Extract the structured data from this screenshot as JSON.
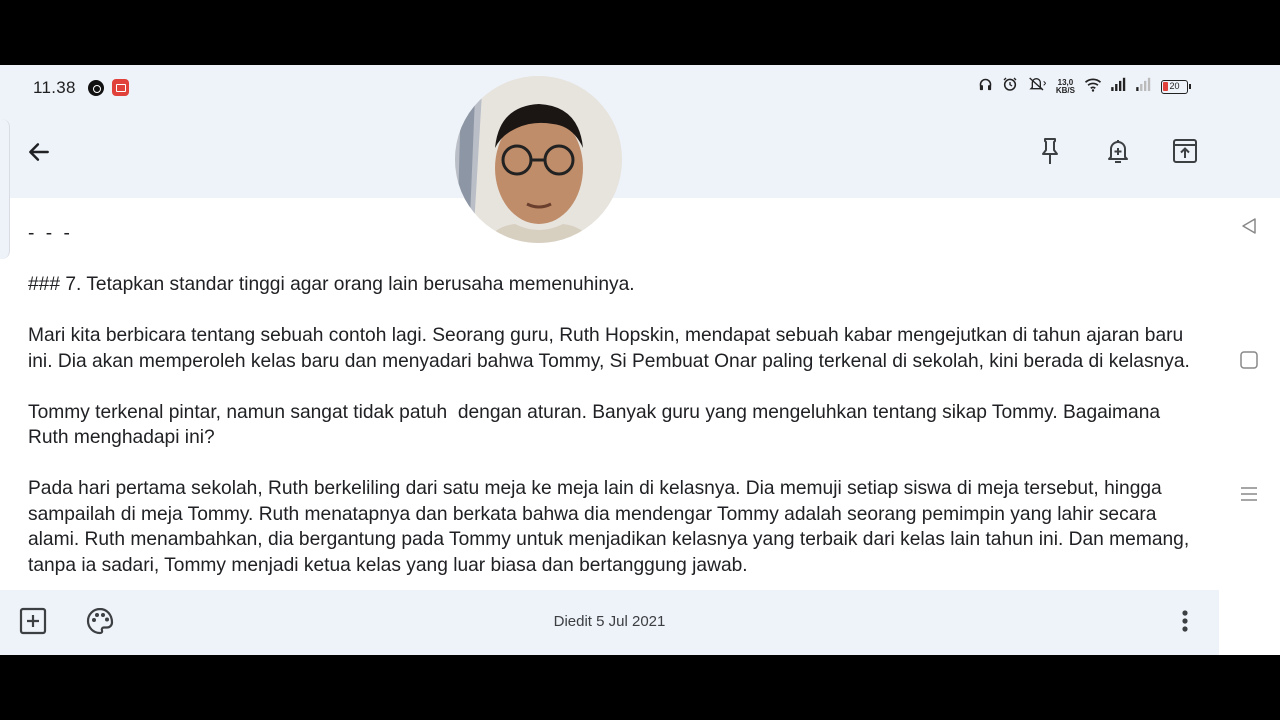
{
  "status_bar": {
    "time": "11.38",
    "network_speed": "13,0",
    "network_speed_unit": "KB/S",
    "battery_level": "20"
  },
  "toolbar": {
    "back_icon": "arrow-left-icon",
    "pin_icon": "pin-icon",
    "reminder_icon": "bell-plus-icon",
    "archive_icon": "archive-icon"
  },
  "note": {
    "separator": "- - -",
    "heading": "### 7. Tetapkan standar tinggi agar orang lain berusaha memenuhinya.",
    "paragraphs": [
      "Mari kita berbicara tentang sebuah contoh lagi. Seorang guru, Ruth Hopskin, mendapat sebuah kabar mengejutkan di tahun ajaran baru ini. Dia akan memperoleh kelas baru dan menyadari bahwa Tommy, Si Pembuat Onar paling terkenal di sekolah, kini berada di kelasnya.",
      "Tommy terkenal pintar, namun sangat tidak patuh  dengan aturan. Banyak guru yang mengeluhkan tentang sikap Tommy. Bagaimana Ruth menghadapi ini?",
      "Pada hari pertama sekolah, Ruth berkeliling dari satu meja ke meja lain di kelasnya. Dia memuji setiap siswa di meja tersebut, hingga sampailah di meja Tommy. Ruth menatapnya dan berkata bahwa dia mendengar Tommy adalah seorang pemimpin yang lahir secara alami. Ruth menambahkan, dia bergantung pada Tommy untuk menjadikan kelasnya yang terbaik dari kelas lain tahun ini. Dan memang, tanpa ia sadari, Tommy menjadi ketua kelas yang luar biasa dan bertanggung jawab."
    ]
  },
  "bottom_bar": {
    "add_icon": "add-box-icon",
    "palette_icon": "palette-icon",
    "edited_label": "Diedit 5 Jul 2021",
    "more_icon": "more-vert-icon"
  },
  "nav_buttons": {
    "back": "triangle-back-icon",
    "home": "square-home-icon",
    "recents": "menu-lines-icon"
  }
}
